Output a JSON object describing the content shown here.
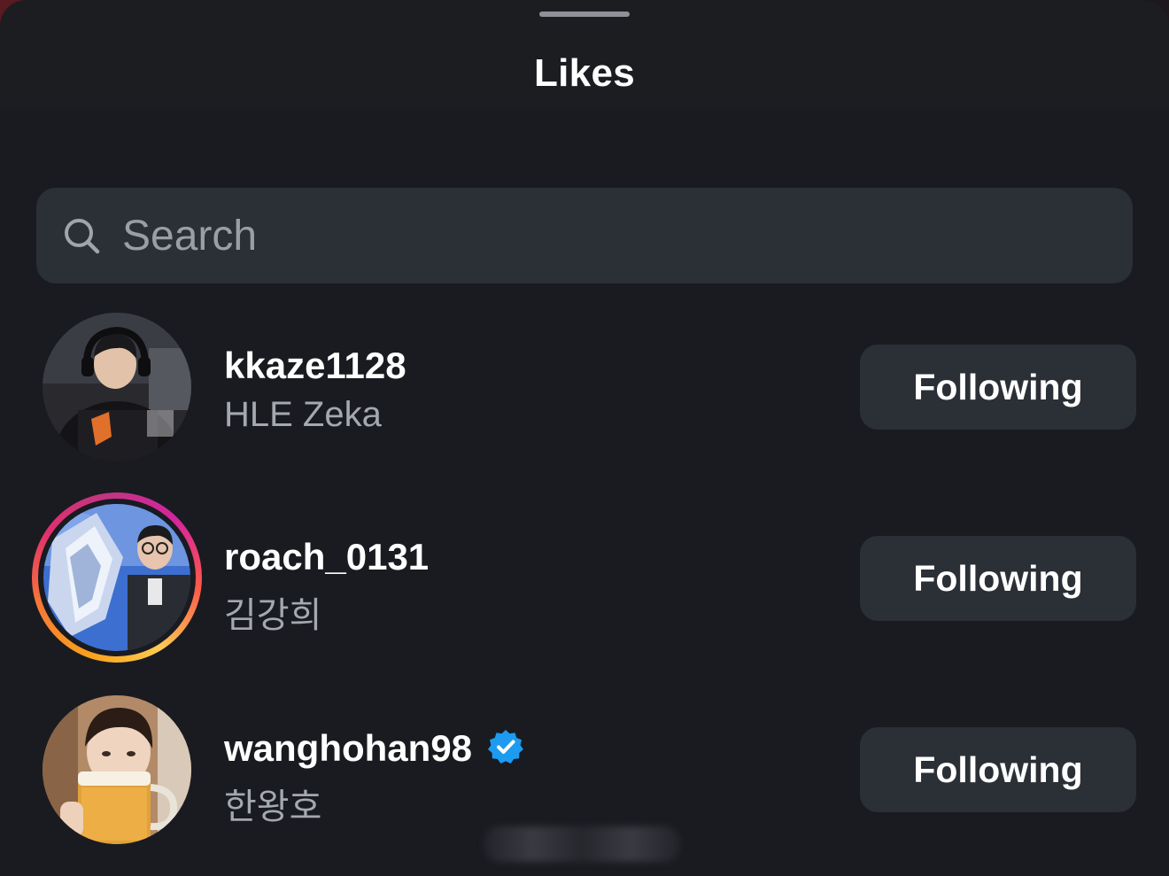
{
  "sheet": {
    "title": "Likes"
  },
  "search": {
    "placeholder": "Search",
    "value": ""
  },
  "users": [
    {
      "username": "kkaze1128",
      "full_name": "HLE Zeka",
      "verified": false,
      "has_story_ring": false,
      "button_label": "Following",
      "avatar_icon": "avatar-photo-gamer-headset"
    },
    {
      "username": "roach_0131",
      "full_name": "김강희",
      "verified": false,
      "has_story_ring": true,
      "button_label": "Following",
      "avatar_icon": "avatar-photo-trophy"
    },
    {
      "username": "wanghohan98",
      "full_name": "한왕호",
      "verified": true,
      "has_story_ring": false,
      "button_label": "Following",
      "avatar_icon": "avatar-photo-beer-mug"
    }
  ],
  "colors": {
    "background": "#191b20",
    "surface": "#2b2f36",
    "text_primary": "#ffffff",
    "text_secondary": "#a4a8b0",
    "verified_blue": "#1d9bf0"
  }
}
